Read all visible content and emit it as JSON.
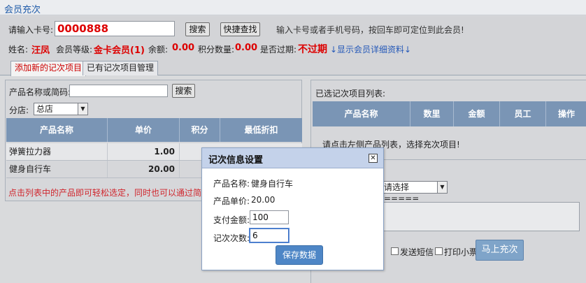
{
  "page": {
    "title": "会员充次"
  },
  "member_search": {
    "label": "请输入卡号:",
    "card_no": "0000888",
    "search_label": "搜索",
    "quick_find_label": "快捷查找",
    "hint": "输入卡号或者手机号码，按回车即可定位到此会员!"
  },
  "member_info": {
    "name_label": "姓名:",
    "name": "汪凤",
    "level_label": "会员等级:",
    "level": "金卡会员(1)",
    "balance_label": "余额:",
    "balance": "0.00",
    "points_label": "积分数量:",
    "points": "0.00",
    "expired_label": "是否过期:",
    "expired": "不过期",
    "detail_link": "↓显示会员详细资料↓"
  },
  "tabs": [
    {
      "label": "添加新的记次项目",
      "active": true
    },
    {
      "label": "已有记次项目管理",
      "active": false
    }
  ],
  "product_filter": {
    "name_label": "产品名称或简码:",
    "search_label": "搜索",
    "store_label": "分店:",
    "store_value": "总店"
  },
  "product_table": {
    "headers": [
      "产品名称",
      "单价",
      "积分",
      "最低折扣"
    ],
    "rows": [
      {
        "name": "弹簧拉力器",
        "price": "1.00"
      },
      {
        "name": "健身自行车",
        "price": "20.00"
      }
    ],
    "hint": "点击列表中的产品即可轻松选定，同时也可以通过简码、名称"
  },
  "selected_panel": {
    "title": "已选记次项目列表:",
    "headers": [
      "产品名称",
      "数里",
      "金额",
      "员工",
      "操作"
    ],
    "empty_hint": "请点击左侧产品列表，选择充次项目!",
    "staff_select": "请选择 =====",
    "sms_label": "发送短信",
    "print_label": "打印小票",
    "submit_label": "马上充次"
  },
  "dialog": {
    "title": "记次信息设置",
    "product_name_label": "产品名称:",
    "product_name": "健身自行车",
    "price_label": "产品单价:",
    "price": "20.00",
    "pay_label": "支付金额:",
    "pay_value": "100",
    "count_label": "记次次数:",
    "count_value": "6",
    "save_label": "保存数据"
  }
}
